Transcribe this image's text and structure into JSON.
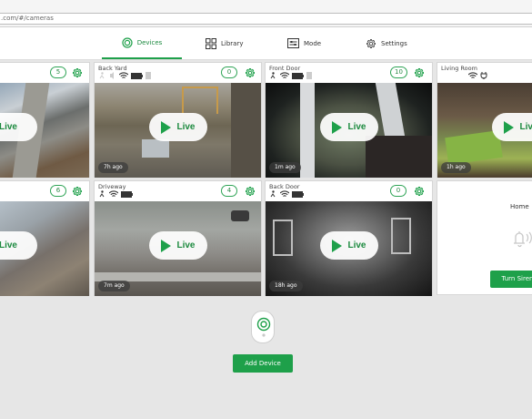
{
  "browser": {
    "url": ".com/#/cameras"
  },
  "nav": {
    "tabs": [
      {
        "label": "Devices",
        "icon": "camera-ring-icon",
        "active": true
      },
      {
        "label": "Library",
        "icon": "grid-icon",
        "active": false
      },
      {
        "label": "Mode",
        "icon": "mode-sliders-icon",
        "active": false
      },
      {
        "label": "Settings",
        "icon": "gear-icon",
        "active": false
      }
    ]
  },
  "cameras": [
    {
      "name": "",
      "count": "5",
      "ago": ""
    },
    {
      "name": "Back Yard",
      "count": "0",
      "ago": "7h ago"
    },
    {
      "name": "Front Door",
      "count": "10",
      "ago": "1m ago"
    },
    {
      "name": "Living Room",
      "count": "",
      "ago": "1h ago"
    },
    {
      "name": "",
      "count": "6",
      "ago": ""
    },
    {
      "name": "Driveway",
      "count": "4",
      "ago": "7m ago"
    },
    {
      "name": "Back Door",
      "count": "0",
      "ago": "18h ago"
    }
  ],
  "live_label": "Live",
  "mode_card": {
    "mode": "Home",
    "siren_button": "Turn Siren"
  },
  "add_device": {
    "button": "Add Device"
  },
  "colors": {
    "accent": "#1ea04a",
    "accent_dark": "#1c8a3f",
    "background": "#e6e6e6"
  }
}
